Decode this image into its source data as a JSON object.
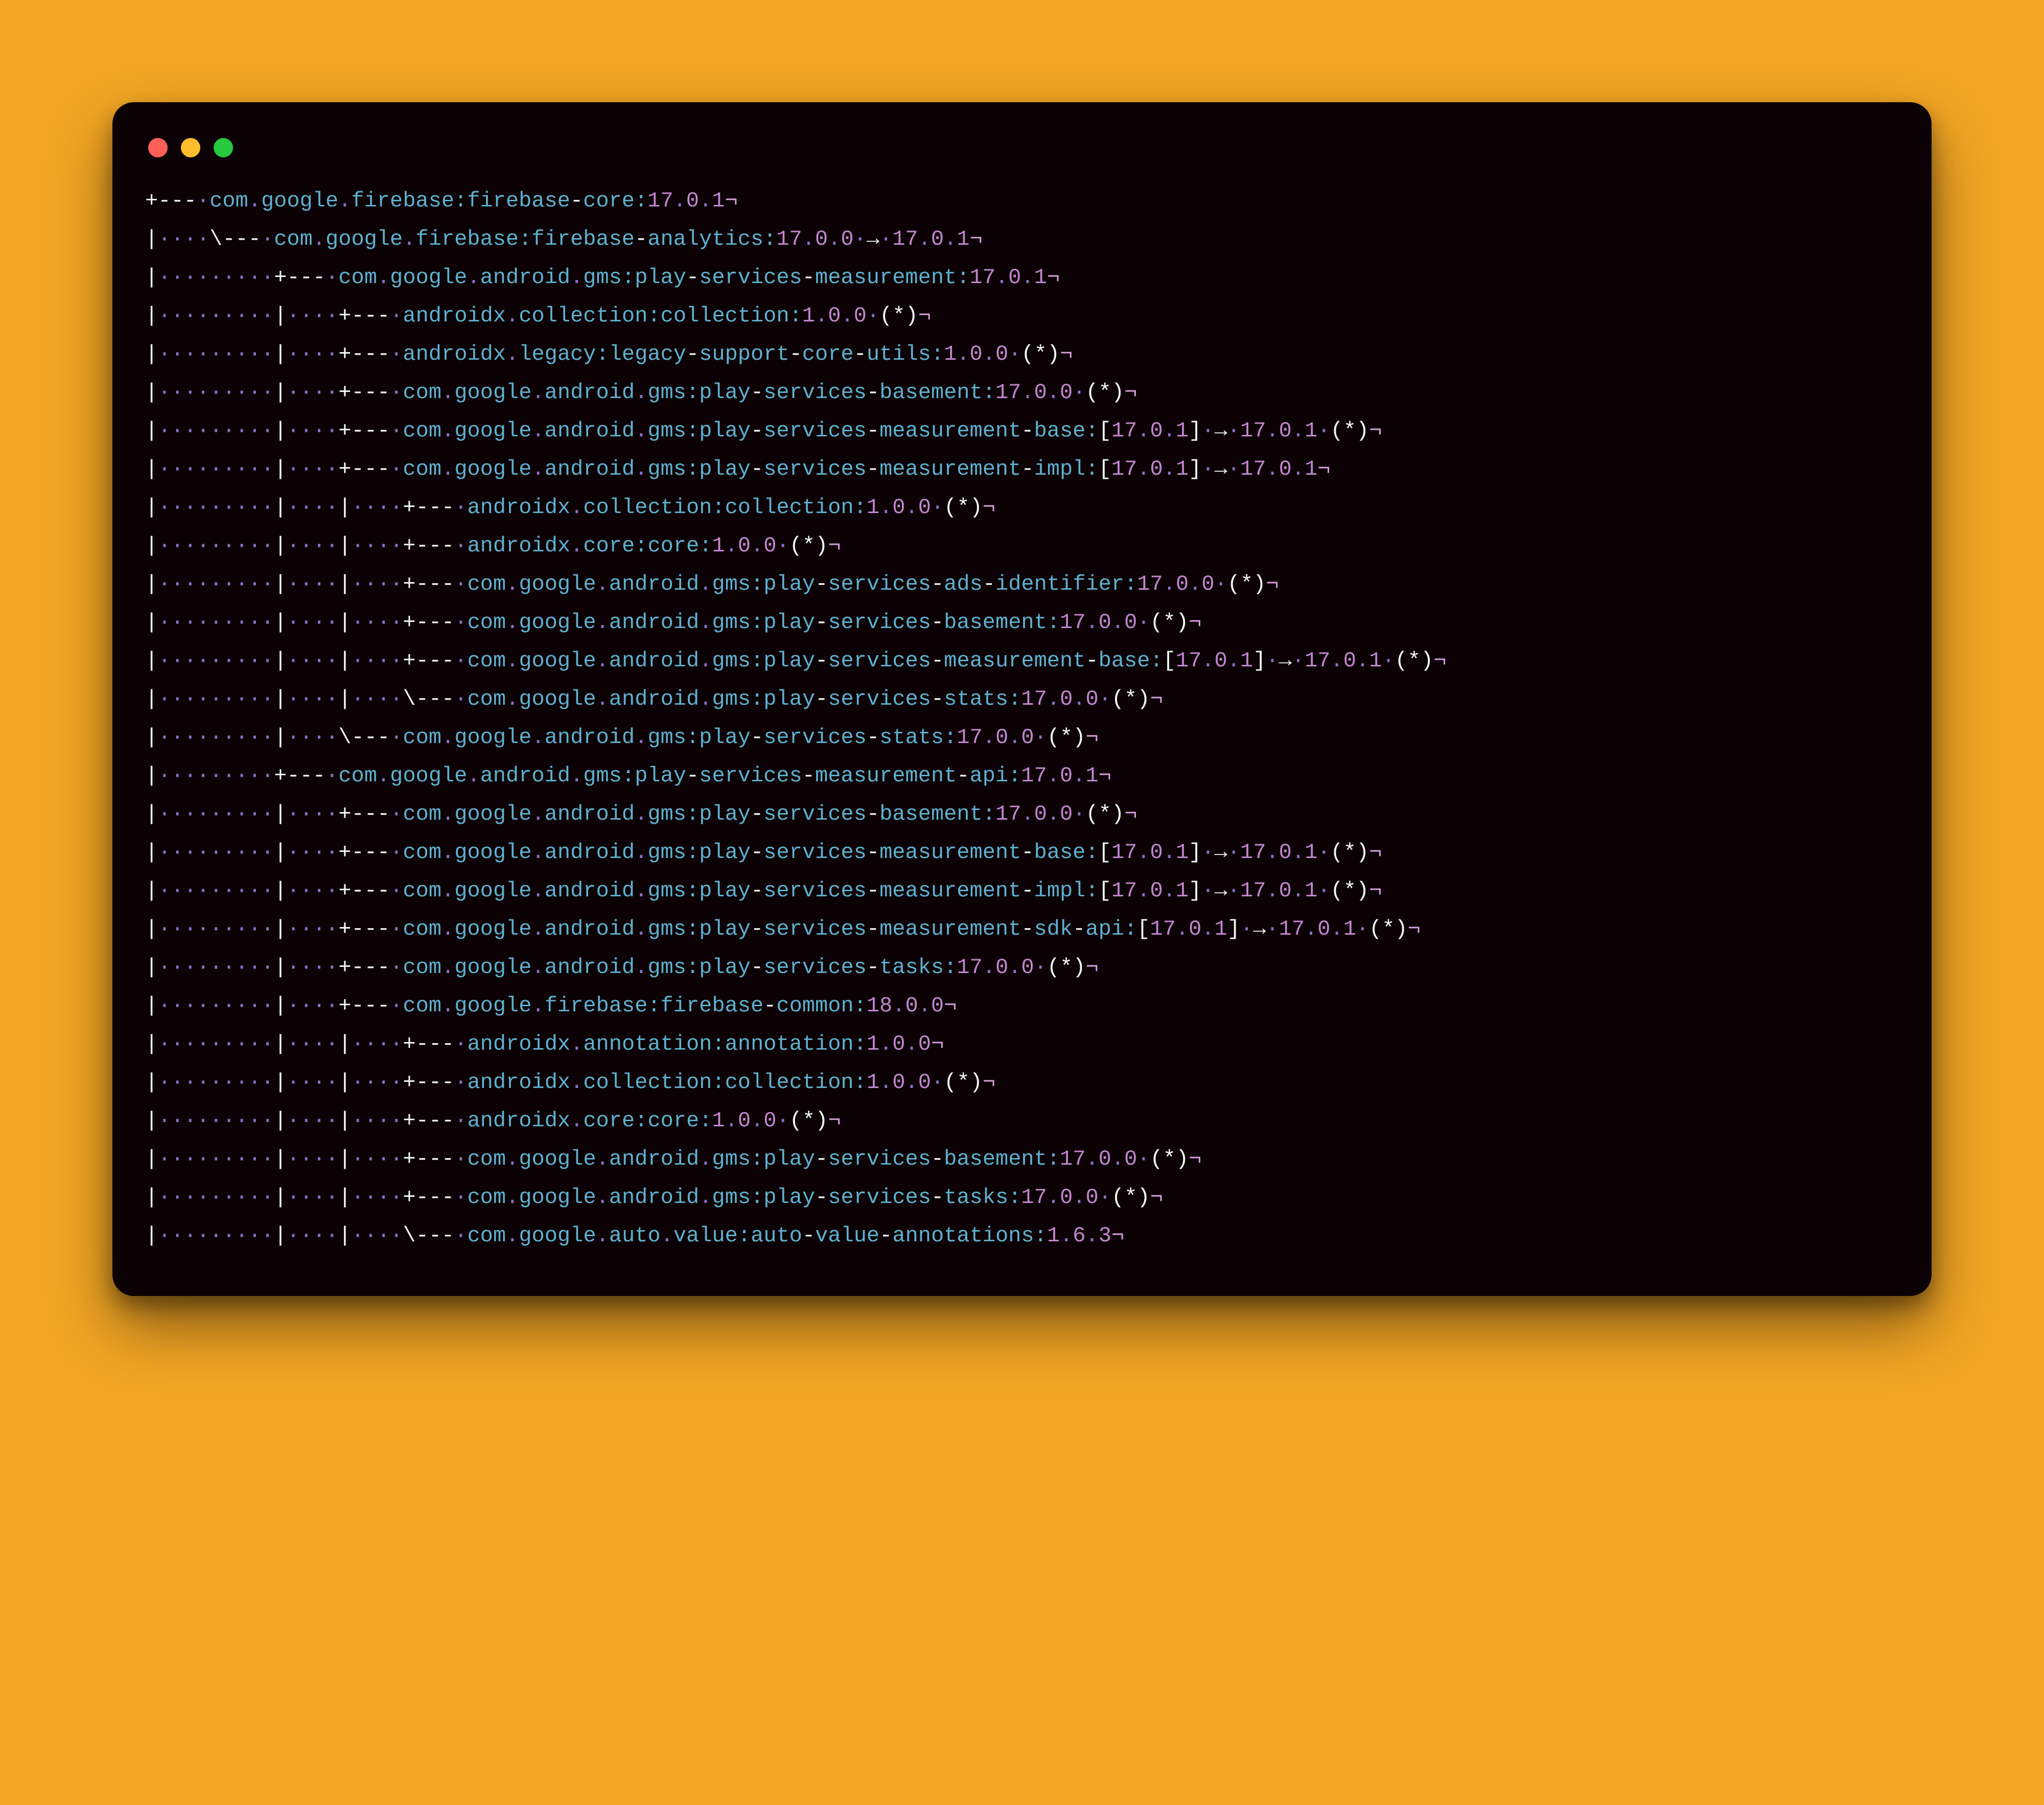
{
  "colors": {
    "background": "#f2a624",
    "window": "#0c0205",
    "tree": "#f7f7f7",
    "dot": "#8a73c9",
    "id": "#5fb0cf",
    "version": "#c386d0",
    "bracket": "#f7f7f7",
    "arrow": "#f7f7f7",
    "star": "#f7f7f7",
    "newline": "#d99fe1",
    "traffic_red": "#ff5f56",
    "traffic_yellow": "#ffbd2e",
    "traffic_green": "#27c93f"
  },
  "glyphs": {
    "middot": "·",
    "arrow": "→",
    "newline_mark": "¬"
  },
  "lines": [
    {
      "prefix": "+---·",
      "group": "com.google.firebase",
      "artifact": "firebase-core",
      "version": "17.0.1"
    },
    {
      "prefix": "|····\\---·",
      "group": "com.google.firebase",
      "artifact": "firebase-analytics",
      "version": "17.0.0",
      "resolved": "17.0.1"
    },
    {
      "prefix": "|·········+---·",
      "group": "com.google.android.gms",
      "artifact": "play-services-measurement",
      "version": "17.0.1"
    },
    {
      "prefix": "|·········|····+---·",
      "group": "androidx.collection",
      "artifact": "collection",
      "version": "1.0.0",
      "star": true
    },
    {
      "prefix": "|·········|····+---·",
      "group": "androidx.legacy",
      "artifact": "legacy-support-core-utils",
      "version": "1.0.0",
      "star": true
    },
    {
      "prefix": "|·········|····+---·",
      "group": "com.google.android.gms",
      "artifact": "play-services-basement",
      "version": "17.0.0",
      "star": true
    },
    {
      "prefix": "|·········|····+---·",
      "group": "com.google.android.gms",
      "artifact": "play-services-measurement-base",
      "bracket_version": "17.0.1",
      "resolved": "17.0.1",
      "star": true
    },
    {
      "prefix": "|·········|····+---·",
      "group": "com.google.android.gms",
      "artifact": "play-services-measurement-impl",
      "bracket_version": "17.0.1",
      "resolved": "17.0.1"
    },
    {
      "prefix": "|·········|····|····+---·",
      "group": "androidx.collection",
      "artifact": "collection",
      "version": "1.0.0",
      "star": true
    },
    {
      "prefix": "|·········|····|····+---·",
      "group": "androidx.core",
      "artifact": "core",
      "version": "1.0.0",
      "star": true
    },
    {
      "prefix": "|·········|····|····+---·",
      "group": "com.google.android.gms",
      "artifact": "play-services-ads-identifier",
      "version": "17.0.0",
      "star": true
    },
    {
      "prefix": "|·········|····|····+---·",
      "group": "com.google.android.gms",
      "artifact": "play-services-basement",
      "version": "17.0.0",
      "star": true
    },
    {
      "prefix": "|·········|····|····+---·",
      "group": "com.google.android.gms",
      "artifact": "play-services-measurement-base",
      "bracket_version": "17.0.1",
      "resolved": "17.0.1",
      "star": true
    },
    {
      "prefix": "|·········|····|····\\---·",
      "group": "com.google.android.gms",
      "artifact": "play-services-stats",
      "version": "17.0.0",
      "star": true
    },
    {
      "prefix": "|·········|····\\---·",
      "group": "com.google.android.gms",
      "artifact": "play-services-stats",
      "version": "17.0.0",
      "star": true
    },
    {
      "prefix": "|·········+---·",
      "group": "com.google.android.gms",
      "artifact": "play-services-measurement-api",
      "version": "17.0.1"
    },
    {
      "prefix": "|·········|····+---·",
      "group": "com.google.android.gms",
      "artifact": "play-services-basement",
      "version": "17.0.0",
      "star": true
    },
    {
      "prefix": "|·········|····+---·",
      "group": "com.google.android.gms",
      "artifact": "play-services-measurement-base",
      "bracket_version": "17.0.1",
      "resolved": "17.0.1",
      "star": true
    },
    {
      "prefix": "|·········|····+---·",
      "group": "com.google.android.gms",
      "artifact": "play-services-measurement-impl",
      "bracket_version": "17.0.1",
      "resolved": "17.0.1",
      "star": true
    },
    {
      "prefix": "|·········|····+---·",
      "group": "com.google.android.gms",
      "artifact": "play-services-measurement-sdk-api",
      "bracket_version": "17.0.1",
      "resolved": "17.0.1",
      "star": true
    },
    {
      "prefix": "|·········|····+---·",
      "group": "com.google.android.gms",
      "artifact": "play-services-tasks",
      "version": "17.0.0",
      "star": true
    },
    {
      "prefix": "|·········|····+---·",
      "group": "com.google.firebase",
      "artifact": "firebase-common",
      "version": "18.0.0"
    },
    {
      "prefix": "|·········|····|····+---·",
      "group": "androidx.annotation",
      "artifact": "annotation",
      "version": "1.0.0"
    },
    {
      "prefix": "|·········|····|····+---·",
      "group": "androidx.collection",
      "artifact": "collection",
      "version": "1.0.0",
      "star": true
    },
    {
      "prefix": "|·········|····|····+---·",
      "group": "androidx.core",
      "artifact": "core",
      "version": "1.0.0",
      "star": true
    },
    {
      "prefix": "|·········|····|····+---·",
      "group": "com.google.android.gms",
      "artifact": "play-services-basement",
      "version": "17.0.0",
      "star": true
    },
    {
      "prefix": "|·········|····|····+---·",
      "group": "com.google.android.gms",
      "artifact": "play-services-tasks",
      "version": "17.0.0",
      "star": true
    },
    {
      "prefix": "|·········|····|····\\---·",
      "group": "com.google.auto.value",
      "artifact": "auto-value-annotations",
      "version": "1.6.3"
    }
  ]
}
